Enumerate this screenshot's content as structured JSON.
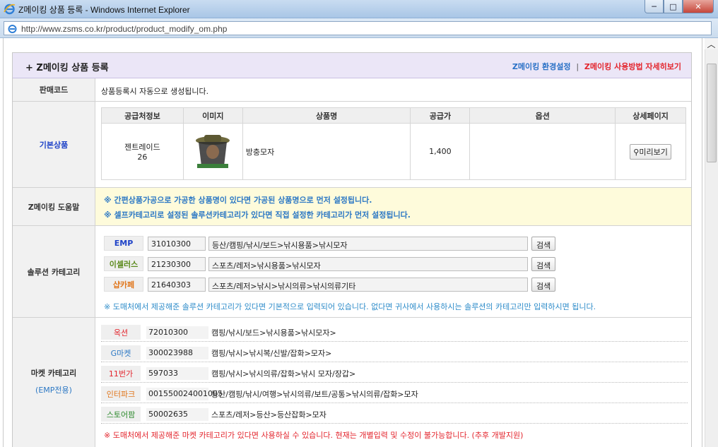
{
  "window": {
    "title": "Z메이킹 상품 등록 - Windows Internet Explorer",
    "min": "─",
    "max": "□",
    "close": "✕"
  },
  "address": {
    "url": "http://www.zsms.co.kr/product/product_modify_om.php"
  },
  "header": {
    "title": "+ Z메이킹 상품 등록",
    "link_settings": "Z메이킹 환경설정",
    "separator": "|",
    "link_help": "Z메이킹 사용방법 자세히보기"
  },
  "sales_code": {
    "label": "판매코드",
    "text": "상품등록시 자동으로 생성됩니다."
  },
  "basic_product": {
    "label": "기본상품",
    "columns": [
      "공급처정보",
      "이미지",
      "상품명",
      "공급가",
      "옵션",
      "상세페이지"
    ],
    "row": {
      "supplier": "젠트레이드",
      "supplier_no": "26",
      "name": "방충모자",
      "price": "1,400",
      "option": "",
      "preview": "미리보기"
    }
  },
  "help": {
    "label": "Z메이킹 도움말",
    "line1": "※ 간편상품가공으로 가공한 상품명이 있다면 가공된 상품명으로 먼저 설정됩니다.",
    "line2": "※ 셀프카테고리로 설정된 솔루션카테고리가 있다면 직접 설정한 카테고리가 먼저 설정됩니다."
  },
  "solution": {
    "label": "솔루션 카테고리",
    "search": "검색",
    "rows": [
      {
        "name": "EMP",
        "color": "#1f43c8",
        "code": "31010300",
        "path": "등산/캠핑/낚시/보드>낚시용품>낚시모자"
      },
      {
        "name": "이셀러스",
        "color": "#5b8a1c",
        "code": "21230300",
        "path": "스포츠/레저>낚시용품>낚시모자"
      },
      {
        "name": "샵카페",
        "color": "#e0761c",
        "code": "21640303",
        "path": "스포츠/레저>낚시>낚시의류>낚시의류기타"
      }
    ],
    "note": "※ 도매처에서 제공해준 솔루션 카테고리가 있다면 기본적으로 입력되어 있습니다. 없다면 귀사에서 사용하시는 솔루션의 카테고리만 입력하시면 됩니다."
  },
  "market": {
    "label": "마켓 카테고리",
    "sublabel": "(EMP전용)",
    "rows": [
      {
        "name": "옥션",
        "color": "#e3252d",
        "code": "72010300",
        "path": "캠핑/낚시/보드>낚시용품>낚시모자>"
      },
      {
        "name": "G마켓",
        "color": "#2c78c4",
        "code": "300023988",
        "path": "캠핑/낚시>낚시복/신발/잡화>모자>"
      },
      {
        "name": "11번가",
        "color": "#e3252d",
        "code": "597033",
        "path": "캠핑/낚시>낚시의류/잡화>낚시 모자/장갑>"
      },
      {
        "name": "인터파크",
        "color": "#e0761c",
        "code": "001550024001005",
        "path": "등산/캠핑/낚시/여행>낚시의류/보트/공통>낚시의류/잡화>모자"
      },
      {
        "name": "스토어팜",
        "color": "#2d8a2d",
        "code": "50002635",
        "path": "스포츠/레저>등산>등산잡화>모자"
      }
    ],
    "note": "※ 도매처에서 제공해준 마켓 카테고리가 있다면 사용하실 수 있습니다. 현재는 개별입력 및 수정이 불가능합니다. (추후 개발지원)"
  }
}
